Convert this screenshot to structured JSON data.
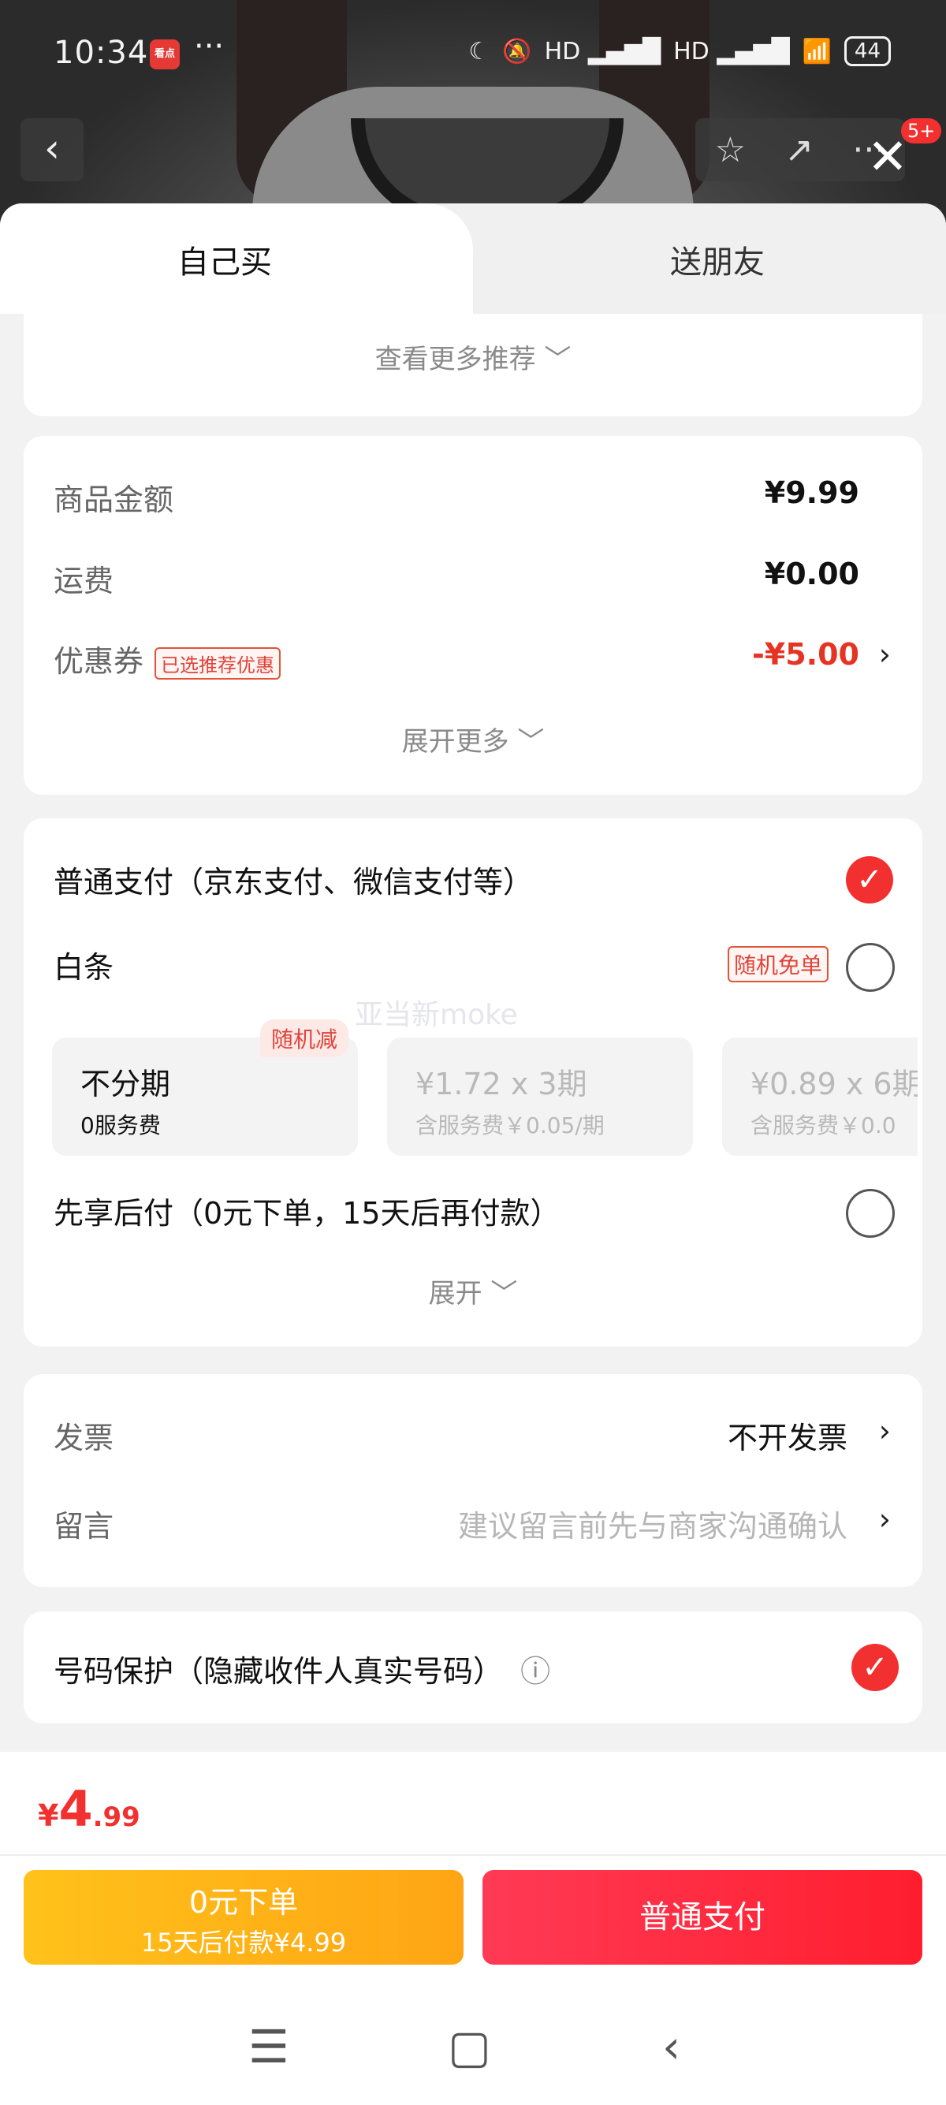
{
  "status_bar": {
    "time": "10:34",
    "app_icon_text": "看点",
    "dots": "···",
    "signal_1": "HD ▂▄▆█",
    "signal_2": "HD ▂▄▆█",
    "battery": "44"
  },
  "top": {
    "back_icon": "‹",
    "star_icon": "☆",
    "share_icon": "↗",
    "more_icon": "···",
    "badge": "5+",
    "close_icon": "✕"
  },
  "tabs": {
    "self": "自己买",
    "gift": "送朋友"
  },
  "recommend": {
    "more_label": "查看更多推荐 ﹀"
  },
  "price": {
    "goods_label": "商品金额",
    "goods_value": "¥9.99",
    "shipping_label": "运费",
    "shipping_value": "¥0.00",
    "coupon_label": "优惠券",
    "coupon_tag": "已选推荐优惠",
    "coupon_value": "-¥5.00",
    "expand_more": "展开更多 ﹀",
    "accent": "#e63322"
  },
  "payment": {
    "normal_label": "普通支付（京东支付、微信支付等）",
    "baitiao_label": "白条",
    "baitiao_tag": "随机免单",
    "plans": [
      {
        "title": "不分期",
        "sub": "0服务费",
        "badge": "随机减"
      },
      {
        "title": "¥1.72 x 3期",
        "sub": "含服务费￥0.05/期"
      },
      {
        "title": "¥0.89 x 6期",
        "sub": "含服务费￥0.0"
      }
    ],
    "bnpl_label": "先享后付（0元下单，15天后再付款）",
    "expand": "展开 ﹀"
  },
  "watermark": "亚当新moke",
  "invoice": {
    "label": "发票",
    "value": "不开发票",
    "message_label": "留言",
    "message_placeholder": "建议留言前先与商家沟通确认"
  },
  "privacy": {
    "label": "号码保护（隐藏收件人真实号码）",
    "info_icon": "ⓘ"
  },
  "footer": {
    "currency": "¥",
    "total_int": "4",
    "total_dec": ".99",
    "btn_zero_line1": "0元下单",
    "btn_zero_line2": "15天后付款¥4.99",
    "btn_pay": "普通支付",
    "nav_menu": "☰",
    "nav_home": "▢",
    "nav_back": "‹"
  }
}
